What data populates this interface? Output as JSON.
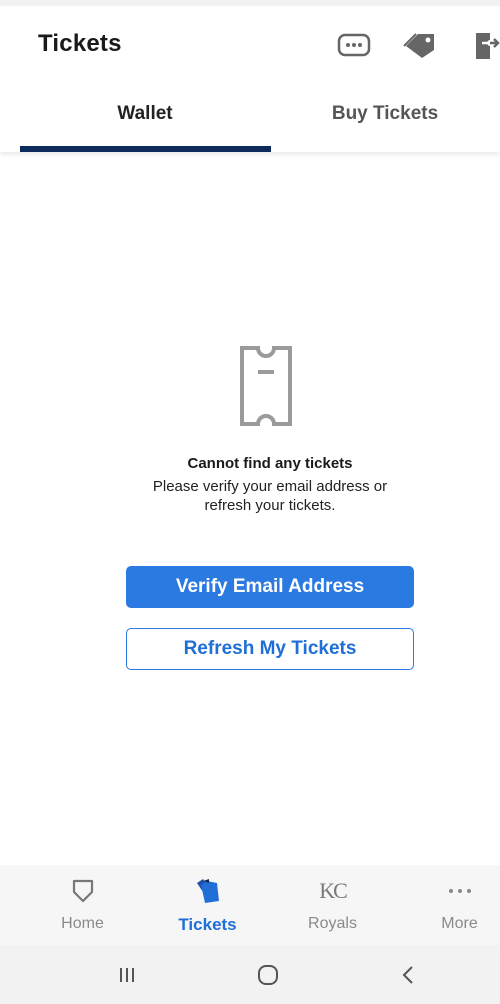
{
  "header": {
    "title": "Tickets",
    "icons": [
      "chat-bubble-icon",
      "tag-icon",
      "transfer-ticket-icon"
    ]
  },
  "tabs": [
    {
      "label": "Wallet",
      "active": true
    },
    {
      "label": "Buy Tickets",
      "active": false
    }
  ],
  "empty_state": {
    "icon": "ticket-outline-icon",
    "title": "Cannot find any tickets",
    "message": "Please verify your email address or refresh your tickets."
  },
  "actions": {
    "verify_label": "Verify Email Address",
    "refresh_label": "Refresh My Tickets"
  },
  "bottom_nav": {
    "items": [
      {
        "label": "Home",
        "icon": "home-plate-icon",
        "active": false
      },
      {
        "label": "Tickets",
        "icon": "tickets-icon",
        "active": true
      },
      {
        "label": "Royals",
        "icon": "royals-logo-icon",
        "active": false,
        "logo_text": "KC"
      },
      {
        "label": "More",
        "icon": "more-dots-icon",
        "active": false
      }
    ]
  },
  "system_nav": [
    "recent-apps-icon",
    "home-circle-icon",
    "back-icon"
  ],
  "colors": {
    "accent": "#2a7ae2",
    "tab_indicator": "#0c2a5b",
    "active_nav": "#1f6fd6",
    "inactive": "#8a8a8a"
  }
}
